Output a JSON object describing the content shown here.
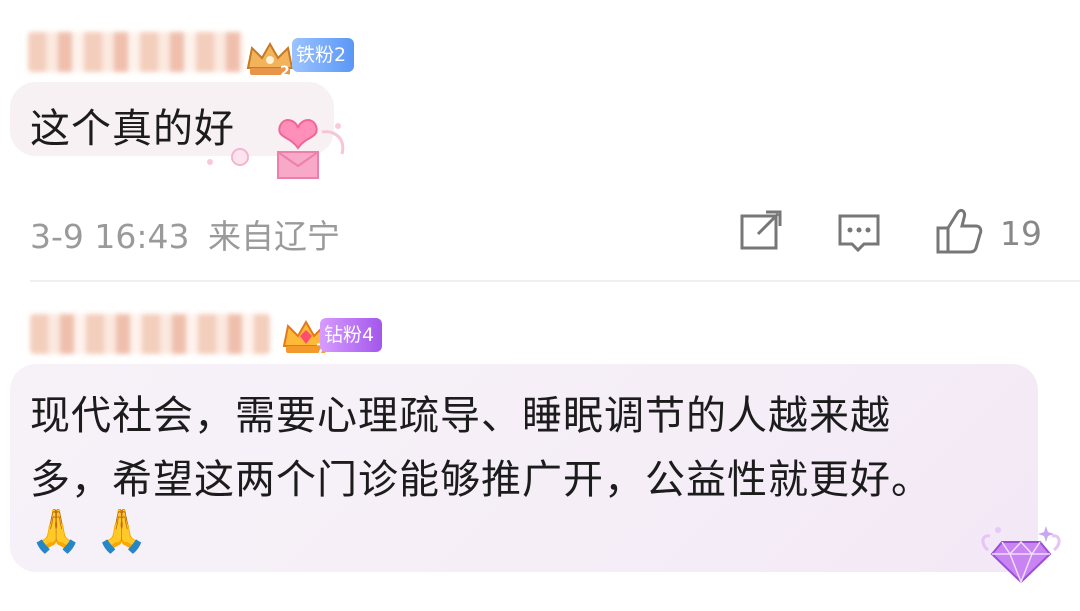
{
  "comments": [
    {
      "fan_badge": {
        "label": "铁粉",
        "level": "2"
      },
      "text": "这个真的好",
      "timestamp": "3-9 16:43",
      "location": "来自辽宁",
      "like_count": "19",
      "icons": [
        "crown-icon",
        "heart-envelope-sticker",
        "share-icon",
        "comment-icon",
        "like-icon"
      ]
    },
    {
      "fan_badge": {
        "label": "钻粉",
        "level": "4"
      },
      "text": "现代社会，需要心理疏导、睡眠调节的人越来越多，希望这两个门诊能够推广开，公益性就更好。",
      "emoji": "🙏 🙏",
      "icons": [
        "crown-icon",
        "diamond-sticker"
      ]
    }
  ],
  "colors": {
    "iron_badge": "#5a97f6",
    "diamond_badge": "#a357ec",
    "meta_text": "#9a9a9a",
    "bubble_bg": "#f7f1f3"
  }
}
